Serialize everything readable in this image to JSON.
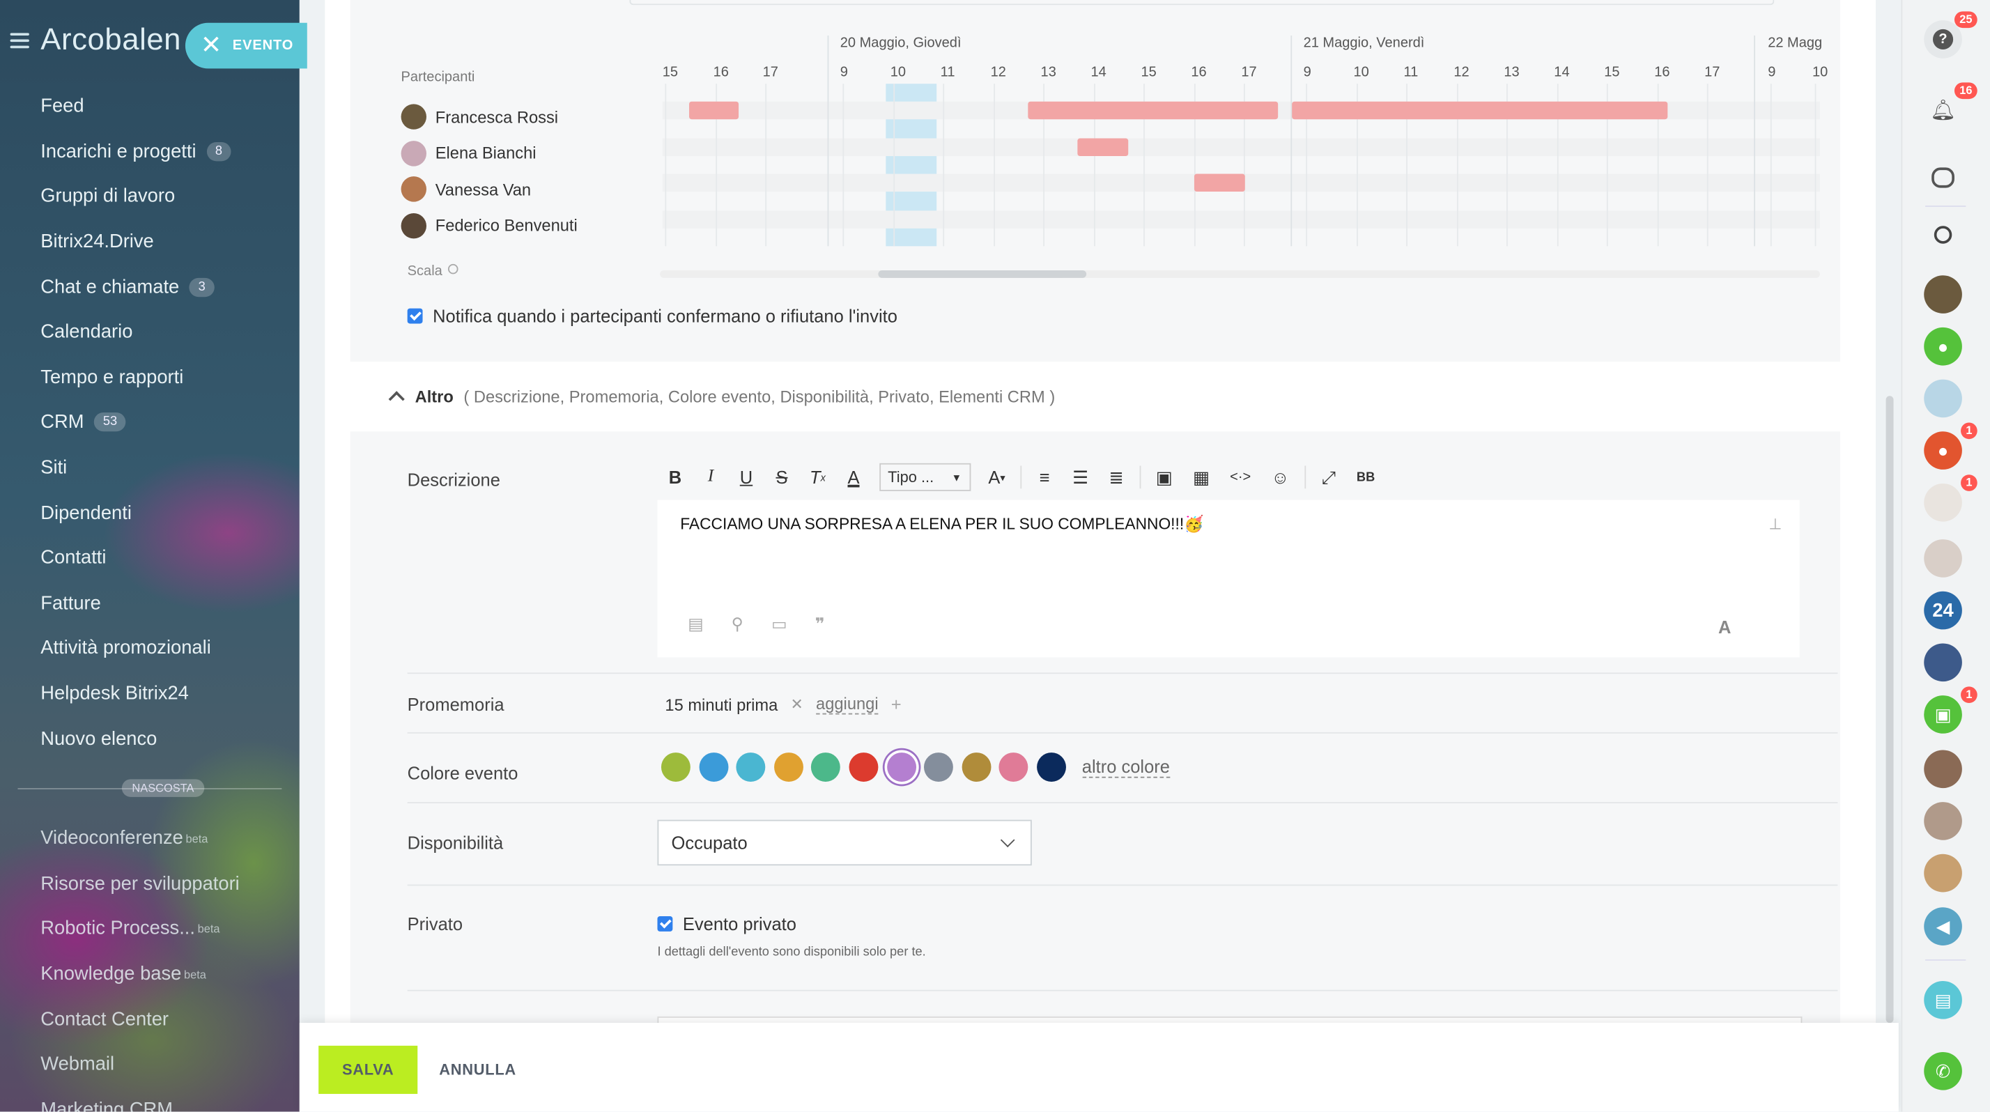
{
  "sidebar": {
    "logo": "Arcobalen",
    "evento_label": "EVENTO",
    "items": [
      {
        "label": "Feed",
        "badge": ""
      },
      {
        "label": "Incarichi e progetti",
        "badge": "8"
      },
      {
        "label": "Gruppi di lavoro",
        "badge": ""
      },
      {
        "label": "Bitrix24.Drive",
        "badge": ""
      },
      {
        "label": "Chat e chiamate",
        "badge": "3"
      },
      {
        "label": "Calendario",
        "badge": ""
      },
      {
        "label": "Tempo e rapporti",
        "badge": ""
      },
      {
        "label": "CRM",
        "badge": "53"
      },
      {
        "label": "Siti",
        "badge": ""
      },
      {
        "label": "Dipendenti",
        "badge": ""
      },
      {
        "label": "Contatti",
        "badge": ""
      },
      {
        "label": "Fatture",
        "badge": ""
      },
      {
        "label": "Attività promozionali",
        "badge": ""
      },
      {
        "label": "Helpdesk Bitrix24",
        "badge": ""
      },
      {
        "label": "Nuovo elenco",
        "badge": ""
      }
    ],
    "hidden_label": "NASCOSTA",
    "hidden_items": [
      {
        "label": "Videoconferenze",
        "sup": "beta"
      },
      {
        "label": "Risorse per sviluppatori",
        "sup": ""
      },
      {
        "label": "Robotic Process...",
        "sup": "beta"
      },
      {
        "label": "Knowledge base",
        "sup": "beta"
      },
      {
        "label": "Contact Center",
        "sup": ""
      },
      {
        "label": "Webmail",
        "sup": ""
      },
      {
        "label": "Marketing CRM",
        "sup": ""
      }
    ]
  },
  "planner": {
    "participants_label": "Partecipanti",
    "scale_label": "Scala",
    "dates": [
      "20 Maggio, Giovedì",
      "21 Maggio, Venerdì",
      "22 Magg"
    ],
    "hours_left": [
      "15",
      "16",
      "17"
    ],
    "hours_day1": [
      "9",
      "10",
      "11",
      "12",
      "13",
      "14",
      "15",
      "16",
      "17"
    ],
    "hours_day2": [
      "9",
      "10",
      "11",
      "12",
      "13",
      "14",
      "15",
      "16",
      "17"
    ],
    "hours_day3": [
      "9",
      "10"
    ],
    "participants": [
      {
        "name": "Francesca Rossi",
        "avatar_color": "#6b5a3e"
      },
      {
        "name": "Elena Bianchi",
        "avatar_color": "#c9a9b6"
      },
      {
        "name": "Vanessa Van",
        "avatar_color": "#b5784f"
      },
      {
        "name": "Federico Benvenuti",
        "avatar_color": "#5a4838"
      }
    ],
    "busy_color": "#f2a5a5",
    "selection_color": "#c6e4f3"
  },
  "notify_label": "Notifica quando i partecipanti confermano o rifiutano l'invito",
  "altro": {
    "title": "Altro",
    "links": "( Descrizione,  Promemoria,  Colore evento,  Disponibilità,  Privato,  Elementi CRM )"
  },
  "description": {
    "label": "Descrizione",
    "tipo_label": "Tipo ...",
    "text": "FACCIAMO UNA SORPRESA A ELENA PER IL SUO COMPLEANNO!!!🥳"
  },
  "reminder": {
    "label": "Promemoria",
    "value": "15 minuti prima",
    "add_label": "aggiungi"
  },
  "color": {
    "label": "Colore evento",
    "swatches": [
      "#9dbb3b",
      "#3b9bd9",
      "#4ab6d1",
      "#e0a130",
      "#4cb88a",
      "#dc3b2e",
      "#b47fd0",
      "#848e9c",
      "#b08c3a",
      "#e07b97",
      "#0b2a5c"
    ],
    "selected_index": 6,
    "other_label": "altro colore"
  },
  "availability": {
    "label": "Disponibilità",
    "value": "Occupato"
  },
  "private": {
    "label": "Privato",
    "checkbox_label": "Evento privato",
    "note": "I dettagli dell'evento sono disponibili solo per te."
  },
  "footer": {
    "save_label": "SALVA",
    "cancel_label": "ANNULLA"
  },
  "rightbar": {
    "help_badge": "25",
    "bell_badge": "16",
    "bitrix_label": "24",
    "badges": [
      "1",
      "1",
      "1"
    ]
  }
}
